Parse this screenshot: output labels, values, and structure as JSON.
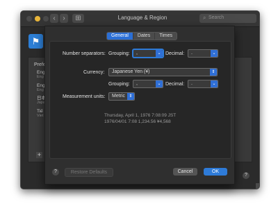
{
  "window": {
    "title": "Language & Region",
    "search_placeholder": "Search",
    "nav_back": "‹",
    "nav_forward": "›",
    "grid_glyph": "⊞"
  },
  "sidebar": {
    "title": "Prefe",
    "items": [
      {
        "label": "Eng",
        "sub": "Eng"
      },
      {
        "label": "Eng",
        "sub": "Eng"
      },
      {
        "label": "日本",
        "sub": "Japa"
      },
      {
        "label": "Tiế",
        "sub": "Viet"
      }
    ],
    "add_label": "+"
  },
  "sheet": {
    "tabs": [
      {
        "label": "General",
        "active": true
      },
      {
        "label": "Dates",
        "active": false
      },
      {
        "label": "Times",
        "active": false
      }
    ],
    "number_separators_label": "Number separators:",
    "grouping_label": "Grouping:",
    "grouping_value": ",",
    "decimal_label": "Decimal:",
    "decimal_value": ".",
    "currency_label": "Currency:",
    "currency_value": "Japanese Yen (¥)",
    "currency_grouping_label": "Grouping:",
    "currency_grouping_value": ",",
    "currency_decimal_label": "Decimal:",
    "currency_decimal_value": ".",
    "measurement_label": "Measurement units:",
    "measurement_value": "Metric",
    "preview_line1": "Thursday, April 1, 1976 7:08:09 JST",
    "preview_line2": "1976/04/01 7:08     1,234.56     ¥4,568",
    "restore_label": "Restore Defaults",
    "cancel_label": "Cancel",
    "ok_label": "OK",
    "help_glyph": "?"
  },
  "colors": {
    "accent": "#2e7bd8",
    "window_bg": "#2b2b2b",
    "sheet_bg": "#2f2f2f"
  }
}
